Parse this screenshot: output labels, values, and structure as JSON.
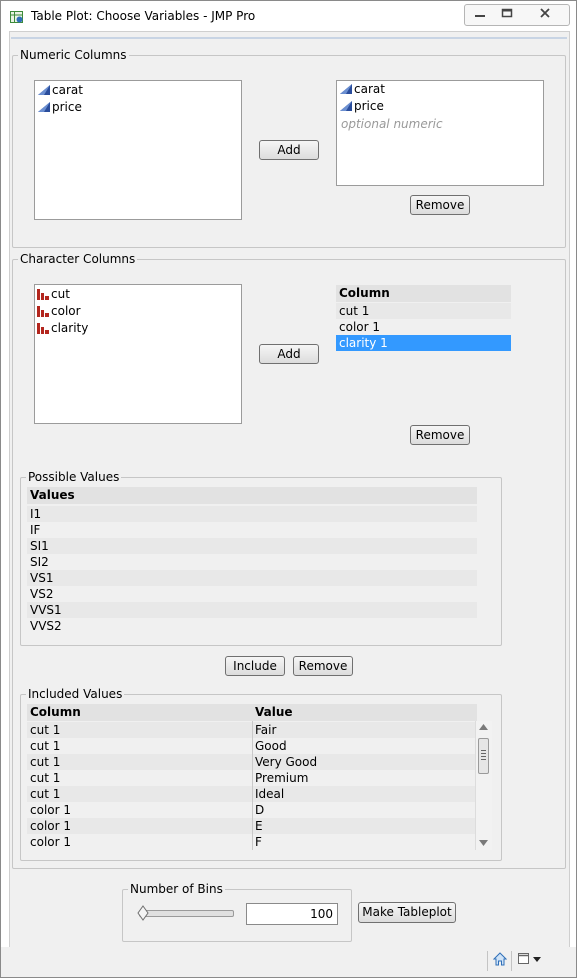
{
  "window": {
    "title": "Table Plot: Choose Variables - JMP Pro",
    "controls": [
      "minimize",
      "maximize",
      "close"
    ]
  },
  "numeric": {
    "legend": "Numeric Columns",
    "available": [
      "carat",
      "price"
    ],
    "selected": [
      "carat",
      "price"
    ],
    "placeholder": "optional numeric",
    "add_label": "Add",
    "remove_label": "Remove"
  },
  "character": {
    "legend": "Character Columns",
    "available": [
      "cut",
      "color",
      "clarity"
    ],
    "column_header": "Column",
    "selected": [
      "cut 1",
      "color 1",
      "clarity 1"
    ],
    "selected_index": 2,
    "add_label": "Add",
    "remove_label": "Remove"
  },
  "possible": {
    "legend": "Possible Values",
    "header": "Values",
    "values": [
      "I1",
      "IF",
      "SI1",
      "SI2",
      "VS1",
      "VS2",
      "VVS1",
      "VVS2"
    ],
    "include_label": "Include",
    "remove_label": "Remove"
  },
  "included": {
    "legend": "Included Values",
    "headers": [
      "Column",
      "Value"
    ],
    "rows": [
      [
        "cut 1",
        "Fair"
      ],
      [
        "cut 1",
        "Good"
      ],
      [
        "cut 1",
        "Very Good"
      ],
      [
        "cut 1",
        "Premium"
      ],
      [
        "cut 1",
        "Ideal"
      ],
      [
        "color 1",
        "D"
      ],
      [
        "color 1",
        "E"
      ],
      [
        "color 1",
        "F"
      ]
    ]
  },
  "bins": {
    "legend": "Number of Bins",
    "value": "100",
    "slider_fraction": 0.0
  },
  "make_label": "Make Tableplot",
  "colors": {
    "selection": "#3399ff",
    "numeric_icon": "#2a4d9c",
    "character_icon": "#b3261e"
  },
  "icons": [
    "numeric-column-icon",
    "character-column-icon",
    "home-icon",
    "window-menu-icon"
  ]
}
